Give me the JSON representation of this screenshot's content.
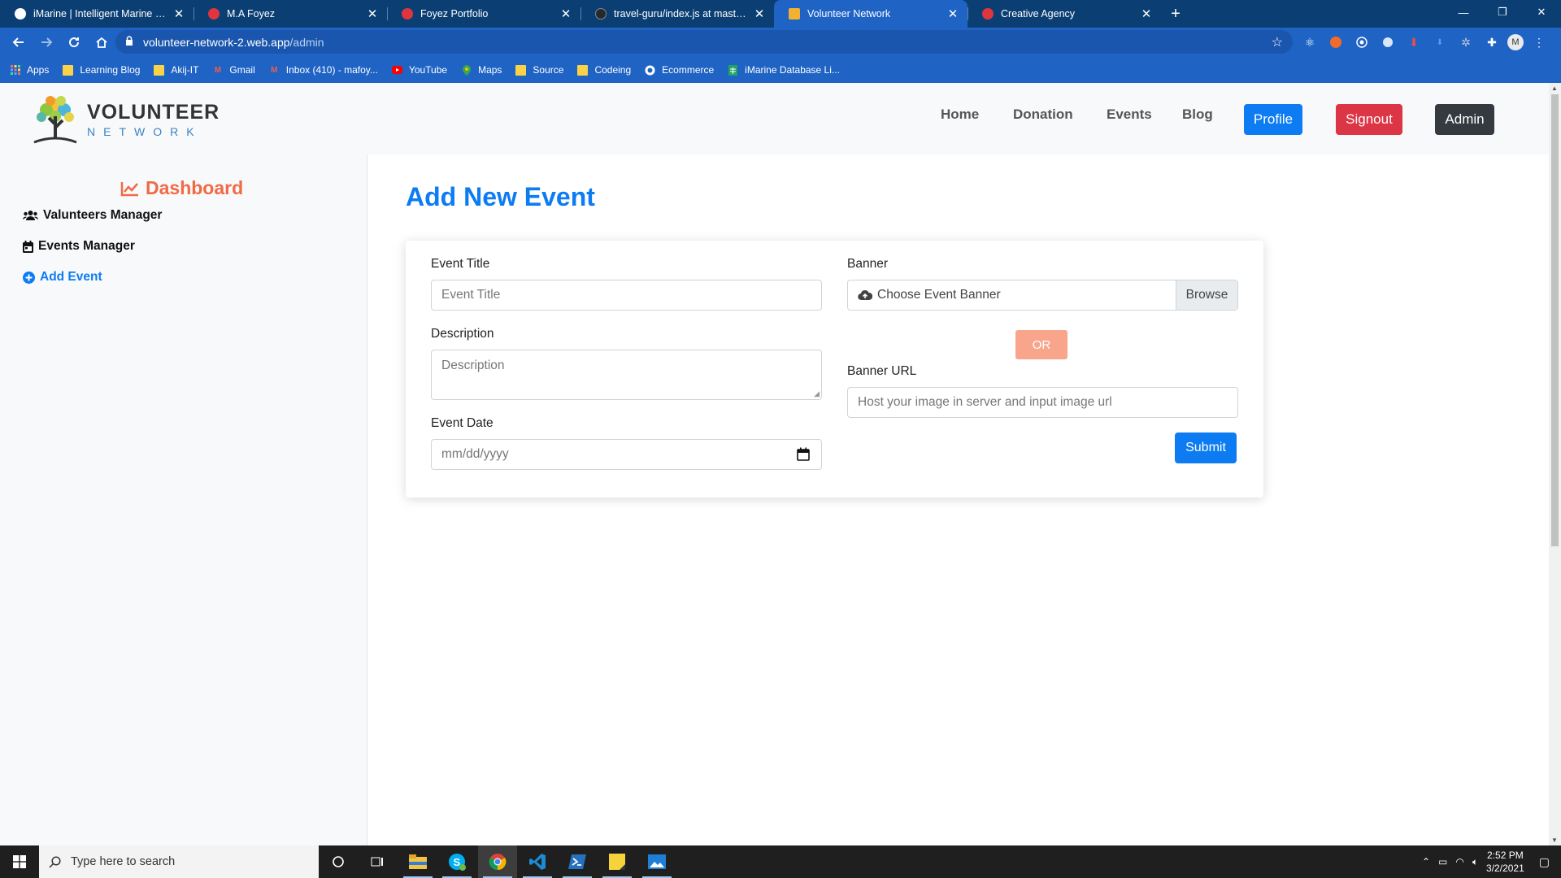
{
  "browser": {
    "tabs": [
      {
        "title": "iMarine | Intelligent Marine Mana",
        "favicon_color": "#ffffff",
        "active": false
      },
      {
        "title": "M.A Foyez",
        "favicon_color": "#e0353f",
        "active": false
      },
      {
        "title": "Foyez Portfolio",
        "favicon_color": "#e0353f",
        "active": false
      },
      {
        "title": "travel-guru/index.js at master · m",
        "favicon_color": "#24292e",
        "active": false
      },
      {
        "title": "Volunteer Network",
        "favicon_color": "#f2b230",
        "active": true
      },
      {
        "title": "Creative Agency",
        "favicon_color": "#e0353f",
        "active": false
      }
    ],
    "close_glyph": "✕",
    "new_tab_glyph": "+",
    "window_controls": {
      "minimize": "—",
      "restore": "❐",
      "close": "✕"
    },
    "url_host": "volunteer-network-2.web.app",
    "url_path": "/admin",
    "profile_initial": "M",
    "bookmarks": [
      {
        "label": "Apps",
        "icon": "apps-grid-icon"
      },
      {
        "label": "Learning Blog",
        "icon": "folder-icon"
      },
      {
        "label": "Akij-IT",
        "icon": "folder-icon"
      },
      {
        "label": "Gmail",
        "icon": "gmail-icon"
      },
      {
        "label": "Inbox (410) - mafoy...",
        "icon": "gmail-icon"
      },
      {
        "label": "YouTube",
        "icon": "youtube-icon"
      },
      {
        "label": "Maps",
        "icon": "maps-icon"
      },
      {
        "label": "Source",
        "icon": "folder-icon"
      },
      {
        "label": "Codeing",
        "icon": "folder-icon"
      },
      {
        "label": "Ecommerce",
        "icon": "globe-icon"
      },
      {
        "label": "iMarine Database Li...",
        "icon": "sheets-icon"
      }
    ]
  },
  "site": {
    "logo_word1": "VOLUNTEER",
    "logo_word2": "NETWORK",
    "nav": {
      "home": "Home",
      "donation": "Donation",
      "events": "Events",
      "blog": "Blog",
      "profile": "Profile",
      "signout": "Signout",
      "admin": "Admin"
    },
    "colors": {
      "primary": "#0d7cf2",
      "danger": "#dc3545",
      "dark": "#343a40",
      "dashboard": "#f06a45",
      "or": "#f8a58c"
    }
  },
  "sidebar": {
    "title": "Dashboard",
    "items": [
      {
        "label": "Valunteers Manager",
        "icon": "users-icon"
      },
      {
        "label": "Events Manager",
        "icon": "calendar-icon"
      },
      {
        "label": "Add Event",
        "icon": "plus-circle-icon"
      }
    ]
  },
  "form": {
    "heading": "Add New Event",
    "event_title_label": "Event Title",
    "event_title_placeholder": "Event Title",
    "description_label": "Description",
    "description_placeholder": "Description",
    "event_date_label": "Event Date",
    "event_date_placeholder": "mm/dd/yyyy",
    "banner_label": "Banner",
    "banner_choose": "Choose Event Banner",
    "banner_browse": "Browse",
    "or_label": "OR",
    "banner_url_label": "Banner URL",
    "banner_url_placeholder": "Host your image in server and input image url",
    "submit": "Submit"
  },
  "taskbar": {
    "search_placeholder": "Type here to search",
    "time": "2:52 PM",
    "date": "3/2/2021"
  }
}
